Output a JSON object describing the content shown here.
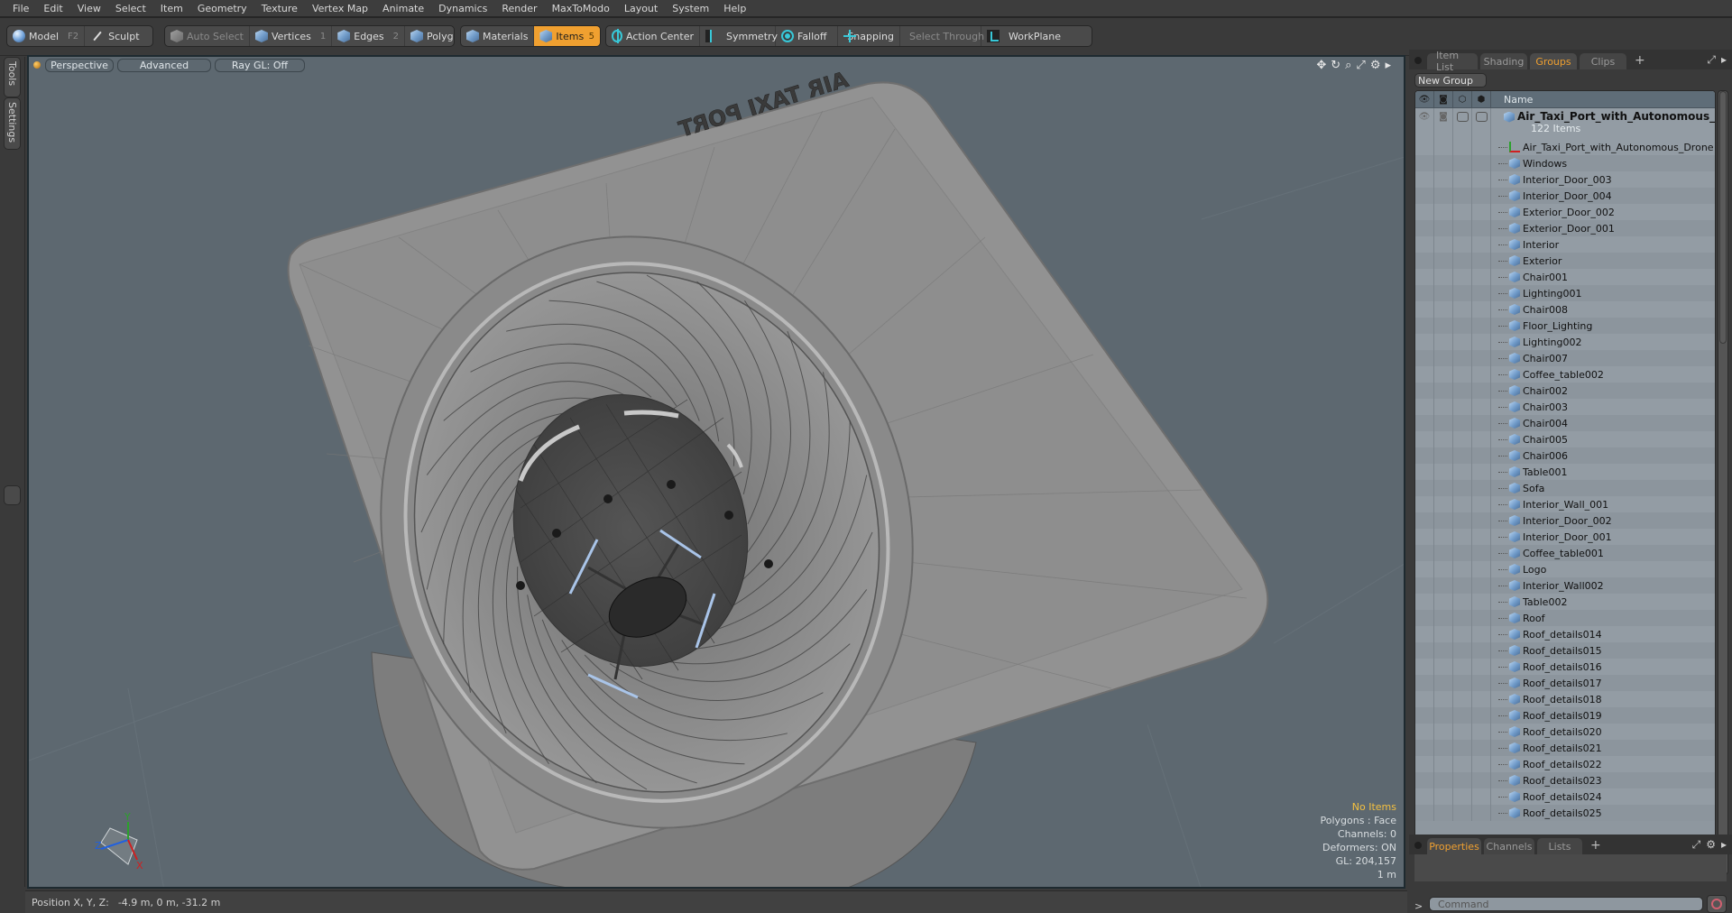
{
  "menubar": {
    "items": [
      "File",
      "Edit",
      "View",
      "Select",
      "Item",
      "Geometry",
      "Texture",
      "Vertex Map",
      "Animate",
      "Dynamics",
      "Render",
      "MaxToModo",
      "Layout",
      "System",
      "Help"
    ]
  },
  "toolbar": {
    "model": {
      "label": "Model",
      "key": "F2"
    },
    "sculpt": {
      "label": "Sculpt"
    },
    "auto_select": {
      "label": "Auto Select"
    },
    "vertices": {
      "label": "Vertices",
      "key": "1"
    },
    "edges": {
      "label": "Edges",
      "key": "2"
    },
    "polygons": {
      "label": "Polygons"
    },
    "materials": {
      "label": "Materials"
    },
    "items": {
      "label": "Items",
      "key": "5"
    },
    "action_center": {
      "label": "Action Center"
    },
    "symmetry": {
      "label": "Symmetry"
    },
    "falloff": {
      "label": "Falloff"
    },
    "snapping": {
      "label": "Snapping"
    },
    "select_through": {
      "label": "Select Through"
    },
    "workplane": {
      "label": "WorkPlane"
    },
    "accent_color": "#f0a030"
  },
  "left_tabs": {
    "tools": "Tools",
    "settings": "Settings"
  },
  "viewport": {
    "view_mode": "Perspective",
    "shading": "Advanced",
    "raygl": "Ray GL: Off",
    "scene_text": "AIR TAXI PORT",
    "axis_labels": {
      "x": "X",
      "y": "Y",
      "z": "Z"
    },
    "info": {
      "selection": "No Items",
      "polygons": "Polygons : Face",
      "channels": "Channels: 0",
      "deformers": "Deformers: ON",
      "gl": "GL: 204,157",
      "scale": "1 m"
    }
  },
  "statusbar": {
    "label": "Position X, Y, Z:",
    "value": "-4.9 m, 0 m, -31.2 m"
  },
  "right_panel": {
    "tabs": [
      "Item List",
      "Shading",
      "Groups",
      "Clips"
    ],
    "active_tab": "Groups",
    "new_group_label": "New Group",
    "column_name": "Name",
    "root": {
      "name": "Air_Taxi_Port_with_Autonomous_...",
      "count": "122 Items"
    },
    "items": [
      {
        "name": "Air_Taxi_Port_with_Autonomous_Drone",
        "type": "locator"
      },
      {
        "name": "Windows",
        "type": "mesh"
      },
      {
        "name": "Interior_Door_003",
        "type": "mesh"
      },
      {
        "name": "Interior_Door_004",
        "type": "mesh"
      },
      {
        "name": "Exterior_Door_002",
        "type": "mesh"
      },
      {
        "name": "Exterior_Door_001",
        "type": "mesh"
      },
      {
        "name": "Interior",
        "type": "mesh"
      },
      {
        "name": "Exterior",
        "type": "mesh"
      },
      {
        "name": "Chair001",
        "type": "mesh"
      },
      {
        "name": "Lighting001",
        "type": "mesh"
      },
      {
        "name": "Chair008",
        "type": "mesh"
      },
      {
        "name": "Floor_Lighting",
        "type": "mesh"
      },
      {
        "name": "Lighting002",
        "type": "mesh"
      },
      {
        "name": "Chair007",
        "type": "mesh"
      },
      {
        "name": "Coffee_table002",
        "type": "mesh"
      },
      {
        "name": "Chair002",
        "type": "mesh"
      },
      {
        "name": "Chair003",
        "type": "mesh"
      },
      {
        "name": "Chair004",
        "type": "mesh"
      },
      {
        "name": "Chair005",
        "type": "mesh"
      },
      {
        "name": "Chair006",
        "type": "mesh"
      },
      {
        "name": "Table001",
        "type": "mesh"
      },
      {
        "name": "Sofa",
        "type": "mesh"
      },
      {
        "name": "Interior_Wall_001",
        "type": "mesh"
      },
      {
        "name": "Interior_Door_002",
        "type": "mesh"
      },
      {
        "name": "Interior_Door_001",
        "type": "mesh"
      },
      {
        "name": "Coffee_table001",
        "type": "mesh"
      },
      {
        "name": "Logo",
        "type": "mesh"
      },
      {
        "name": "Interior_Wall002",
        "type": "mesh"
      },
      {
        "name": "Table002",
        "type": "mesh"
      },
      {
        "name": "Roof",
        "type": "mesh"
      },
      {
        "name": "Roof_details014",
        "type": "mesh"
      },
      {
        "name": "Roof_details015",
        "type": "mesh"
      },
      {
        "name": "Roof_details016",
        "type": "mesh"
      },
      {
        "name": "Roof_details017",
        "type": "mesh"
      },
      {
        "name": "Roof_details018",
        "type": "mesh"
      },
      {
        "name": "Roof_details019",
        "type": "mesh"
      },
      {
        "name": "Roof_details020",
        "type": "mesh"
      },
      {
        "name": "Roof_details021",
        "type": "mesh"
      },
      {
        "name": "Roof_details022",
        "type": "mesh"
      },
      {
        "name": "Roof_details023",
        "type": "mesh"
      },
      {
        "name": "Roof_details024",
        "type": "mesh"
      },
      {
        "name": "Roof_details025",
        "type": "mesh"
      }
    ],
    "bottom_tabs": [
      "Properties",
      "Channels",
      "Lists"
    ],
    "bottom_active_tab": "Properties",
    "command_placeholder": "Command",
    "command_prompt": ">"
  }
}
